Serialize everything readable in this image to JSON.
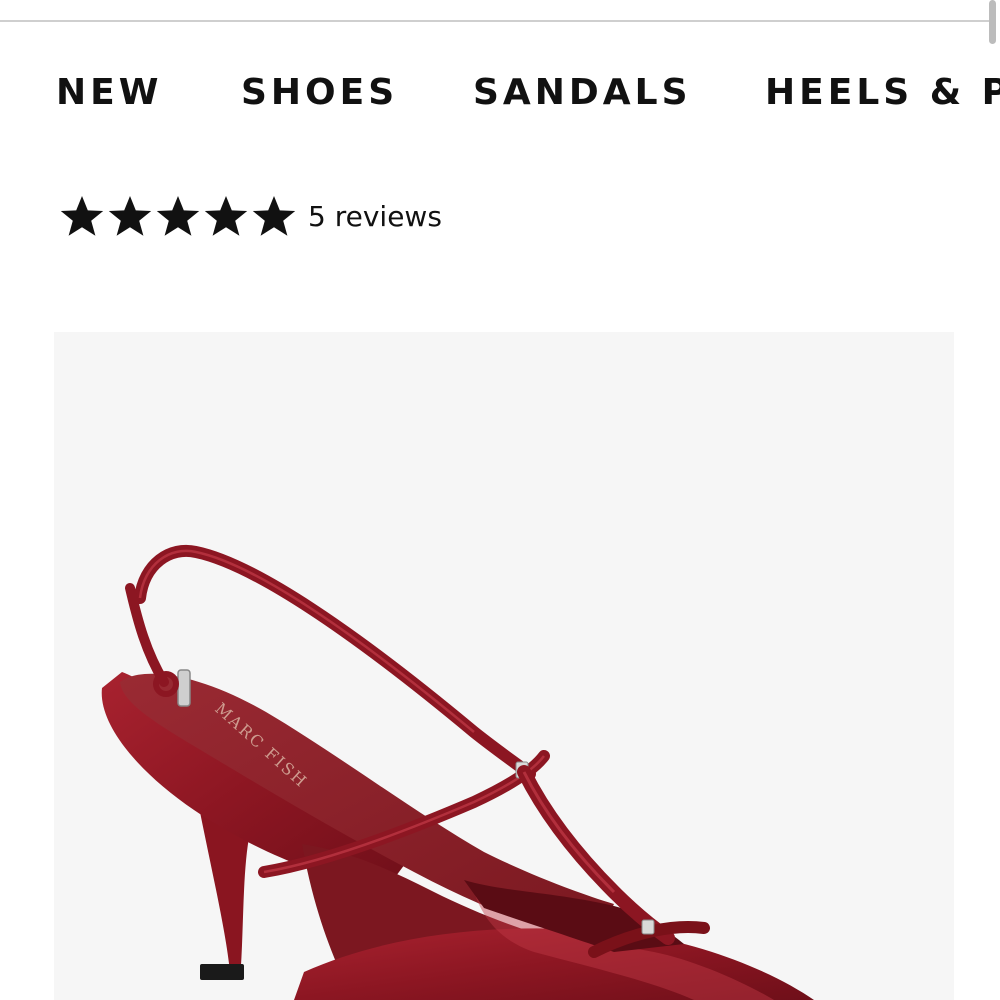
{
  "nav": {
    "items": [
      {
        "label": "NEW"
      },
      {
        "label": "SHOES"
      },
      {
        "label": "SANDALS"
      },
      {
        "label": "HEELS & P"
      }
    ]
  },
  "rating": {
    "stars": 5,
    "max_stars": 5,
    "reviews_text": "5 reviews"
  },
  "product": {
    "image_icon": "red-patent-slingback-heel",
    "insole_brand_text": "MARC FISH",
    "colors": {
      "shoe": "#8c1622",
      "shoe_highlight": "#c23a47",
      "background": "#f6f6f6"
    }
  }
}
